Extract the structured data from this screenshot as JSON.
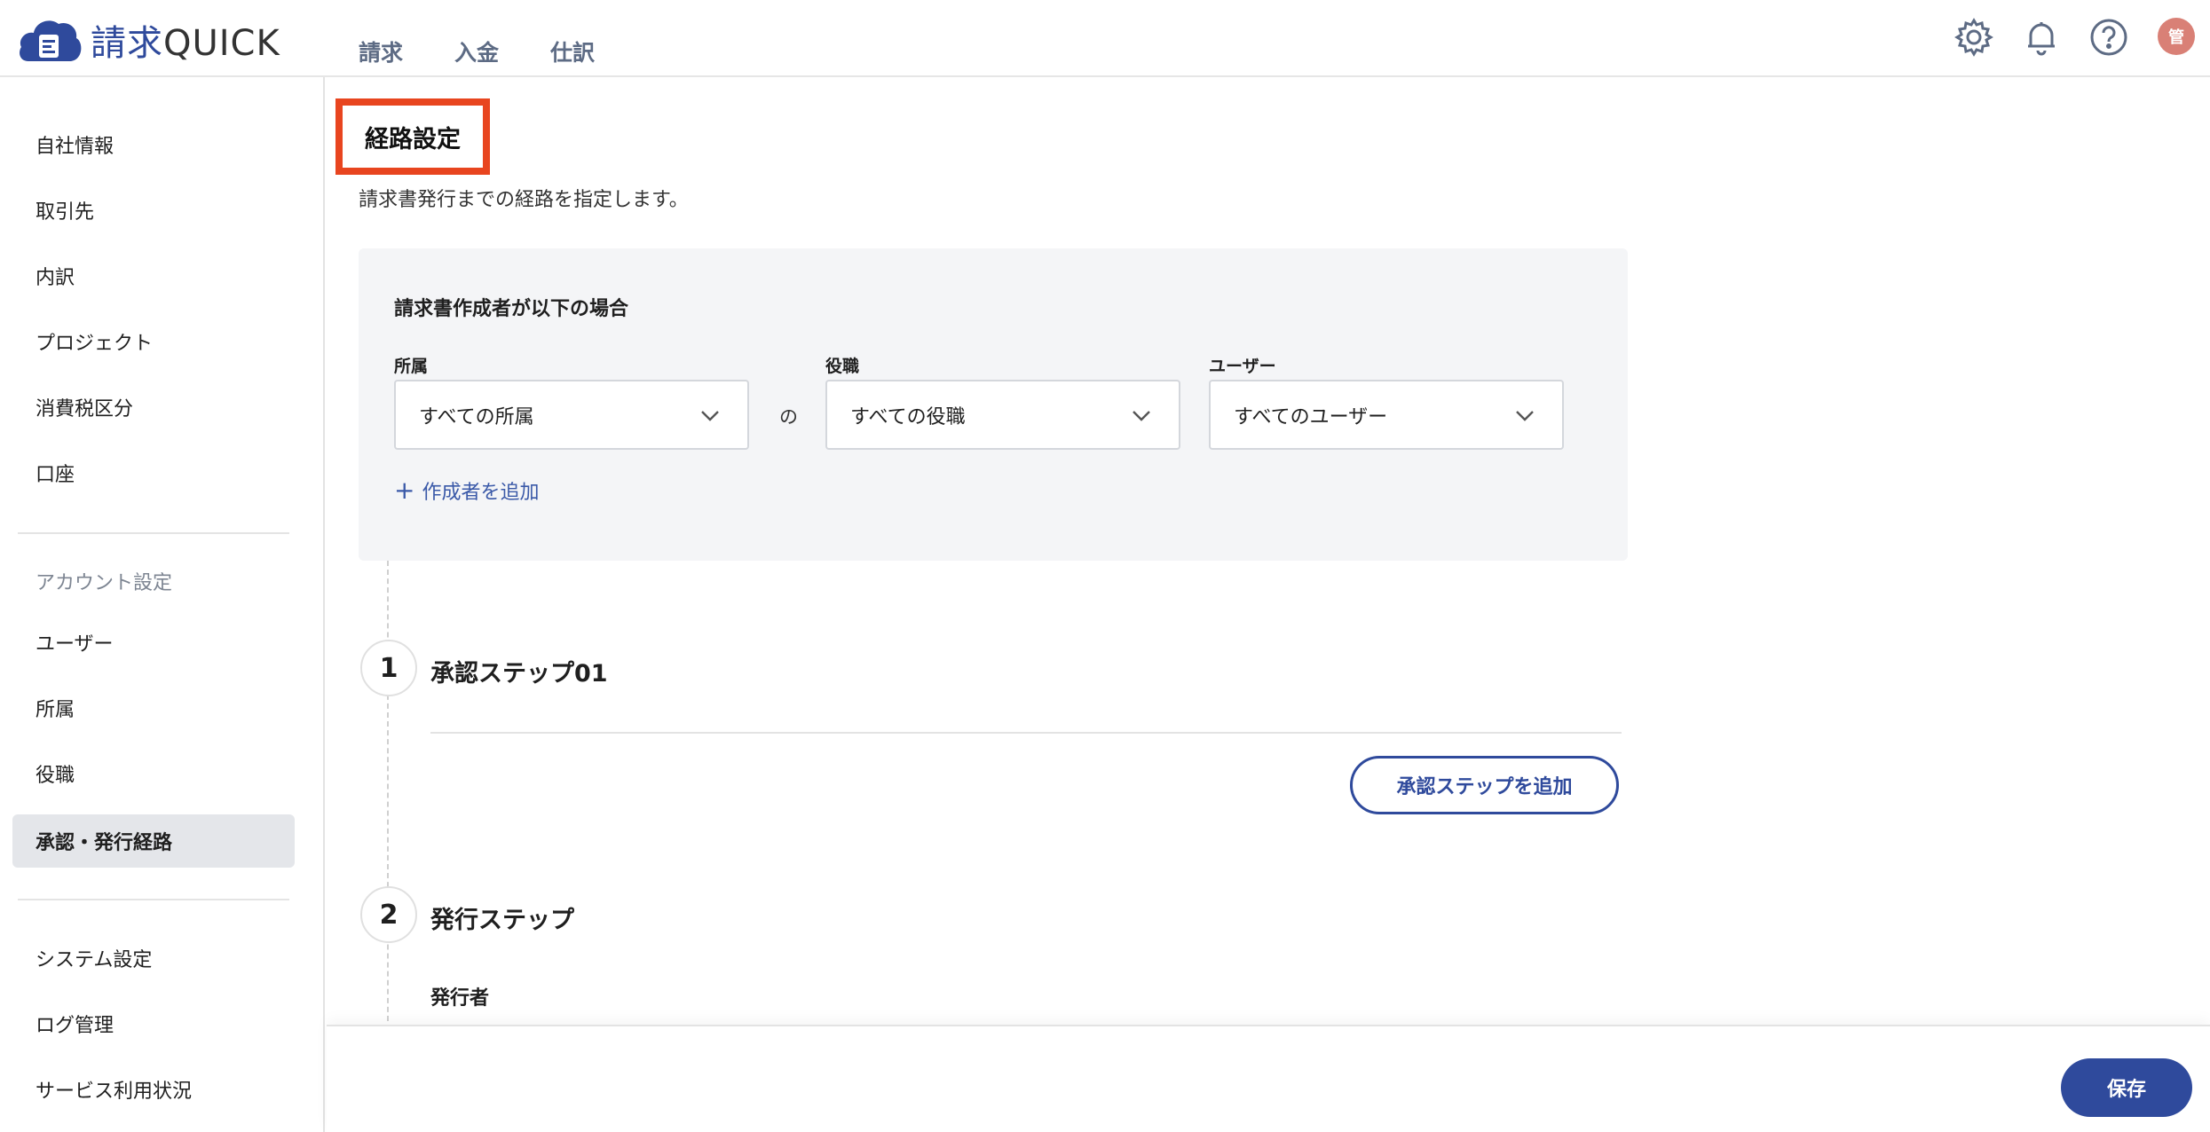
{
  "app": {
    "brand_kanji": "請求",
    "brand_latin": "QUICK"
  },
  "topnav": {
    "items": [
      {
        "label": "請求"
      },
      {
        "label": "入金"
      },
      {
        "label": "仕訳"
      }
    ]
  },
  "header": {
    "avatar_initial": "管",
    "icons": [
      "gear-icon",
      "bell-icon",
      "help-icon"
    ]
  },
  "sidebar": {
    "group1": [
      {
        "label": "自社情報"
      },
      {
        "label": "取引先"
      },
      {
        "label": "内訳"
      },
      {
        "label": "プロジェクト"
      },
      {
        "label": "消費税区分"
      },
      {
        "label": "口座"
      }
    ],
    "account_section": "アカウント設定",
    "group2": [
      {
        "label": "ユーザー"
      },
      {
        "label": "所属"
      },
      {
        "label": "役職"
      },
      {
        "label": "承認・発行経路"
      }
    ],
    "active": "承認・発行経路",
    "group3": [
      {
        "label": "システム設定"
      },
      {
        "label": "ログ管理"
      },
      {
        "label": "サービス利用状況"
      }
    ]
  },
  "page": {
    "title": "経路設定",
    "subtitle": "請求書発行までの経路を指定します。"
  },
  "condition": {
    "title": "請求書作成者が以下の場合",
    "fields": [
      {
        "label": "所属",
        "value": "すべての所属"
      },
      {
        "label": "役職",
        "value": "すべての役職"
      },
      {
        "label": "ユーザー",
        "value": "すべてのユーザー"
      }
    ],
    "of_text": "の",
    "add_creator": "作成者を追加"
  },
  "steps": [
    {
      "number": "1",
      "title": "承認ステップ01"
    },
    {
      "number": "2",
      "title": "発行ステップ"
    }
  ],
  "add_step_button": "承認ステップを追加",
  "issuer_label": "発行者",
  "save_button": "保存",
  "colors": {
    "brand": "#2f4a9c",
    "highlight": "#e8451f",
    "panel_bg": "#f4f5f7",
    "active_nav": "#e4e6ea"
  }
}
